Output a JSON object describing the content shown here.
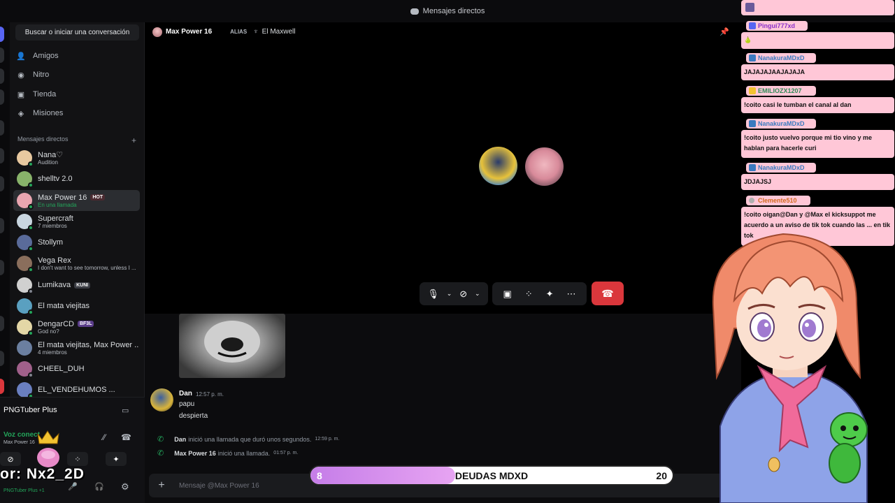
{
  "topbar": {
    "title": "Mensajes directos"
  },
  "sidebar": {
    "search_label": "Buscar o iniciar una conversación",
    "nav": [
      {
        "label": "Amigos",
        "icon": "friends-icon"
      },
      {
        "label": "Nitro",
        "icon": "nitro-icon"
      },
      {
        "label": "Tienda",
        "icon": "store-icon"
      },
      {
        "label": "Misiones",
        "icon": "quests-icon"
      }
    ],
    "dm_header": "Mensajes directos",
    "dms": [
      {
        "name": "Nana♡",
        "sub": "Audition",
        "color": "#e8c9a0"
      },
      {
        "name": "shelltv 2.0",
        "sub": "",
        "color": "#88b36a"
      },
      {
        "name": "Max Power 16",
        "tag": "HOT",
        "sub": "En una llamada",
        "color": "#e9a5b0",
        "active": true
      },
      {
        "name": "Supercraft",
        "sub": "7 miembros",
        "color": "#c9d6e0"
      },
      {
        "name": "Stollym",
        "sub": "",
        "color": "#5a6b9a"
      },
      {
        "name": "Vega Rex",
        "sub": "I don't want to see tomorrow, unless I ...",
        "color": "#8a6e5c"
      },
      {
        "name": "Lumikava",
        "tag": "KUNI",
        "sub": "",
        "color": "#d0d0d0"
      },
      {
        "name": "El mata viejitas",
        "sub": "",
        "color": "#5aa0c0"
      },
      {
        "name": "DengarCD",
        "tag": "BF3L",
        "sub": "God no?",
        "color": "#e4d7a6"
      },
      {
        "name": "El mata viejitas, Max Power ...",
        "sub": "4 miembros",
        "color": "#6b7fa0"
      },
      {
        "name": "CHEEL_DUH",
        "sub": "",
        "color": "#a0608a"
      },
      {
        "name": "EL_VENDEHUMOS ...",
        "sub": "",
        "color": "#6a7fc0"
      }
    ]
  },
  "bottom": {
    "app_title": "PNGTuber Plus",
    "voice_status": "Voz conect",
    "voice_sub": "Max Power 16",
    "streamer_overlay": "or: Nx2_2D",
    "user_sub": "PNGTuber Plus +1"
  },
  "header": {
    "name": "Max Power 16",
    "alias_label": "ALIAS",
    "alias": "El Maxwell"
  },
  "chat": {
    "author": "Dan",
    "time": "12:57 p. m.",
    "lines": [
      "papu",
      "despierta"
    ],
    "system": [
      {
        "who": "Dan",
        "text": "inició una llamada que duró unos segundos.",
        "time": "12:59 p. m."
      },
      {
        "who": "Max Power 16",
        "text": "inició una llamada.",
        "time": "01:57 p. m."
      }
    ],
    "input_placeholder": "Mensaje @Max Power 16"
  },
  "debt_bar": {
    "left": "8",
    "label": "DEUDAS MDXD",
    "right": "20",
    "progress": 0.4
  },
  "stream_chat": [
    {
      "user": "Pingui777xd",
      "text": "🍐",
      "color": "#8b2fc9"
    },
    {
      "user": "NanakuraMDxD",
      "text": "JAJAJAJAAJAJAJA",
      "color": "#3a7abf"
    },
    {
      "user": "EMILIOZX1207",
      "text": "!coito casi le tumban el canal al dan",
      "color": "#2e8b57"
    },
    {
      "user": "NanakuraMDxD",
      "text": "!coito justo vuelvo porque mi tio vino y me hablan para hacerle curi",
      "color": "#3a7abf"
    },
    {
      "user": "NanakuraMDxD",
      "text": "JDJAJSJ",
      "color": "#3a7abf"
    },
    {
      "user": "Clemente510",
      "text": "!coito oigan@Dan y @Max el kicksuppot me acuerdo a un aviso de tik tok cuando las ... en tik tok",
      "color": "#d2691e"
    }
  ]
}
